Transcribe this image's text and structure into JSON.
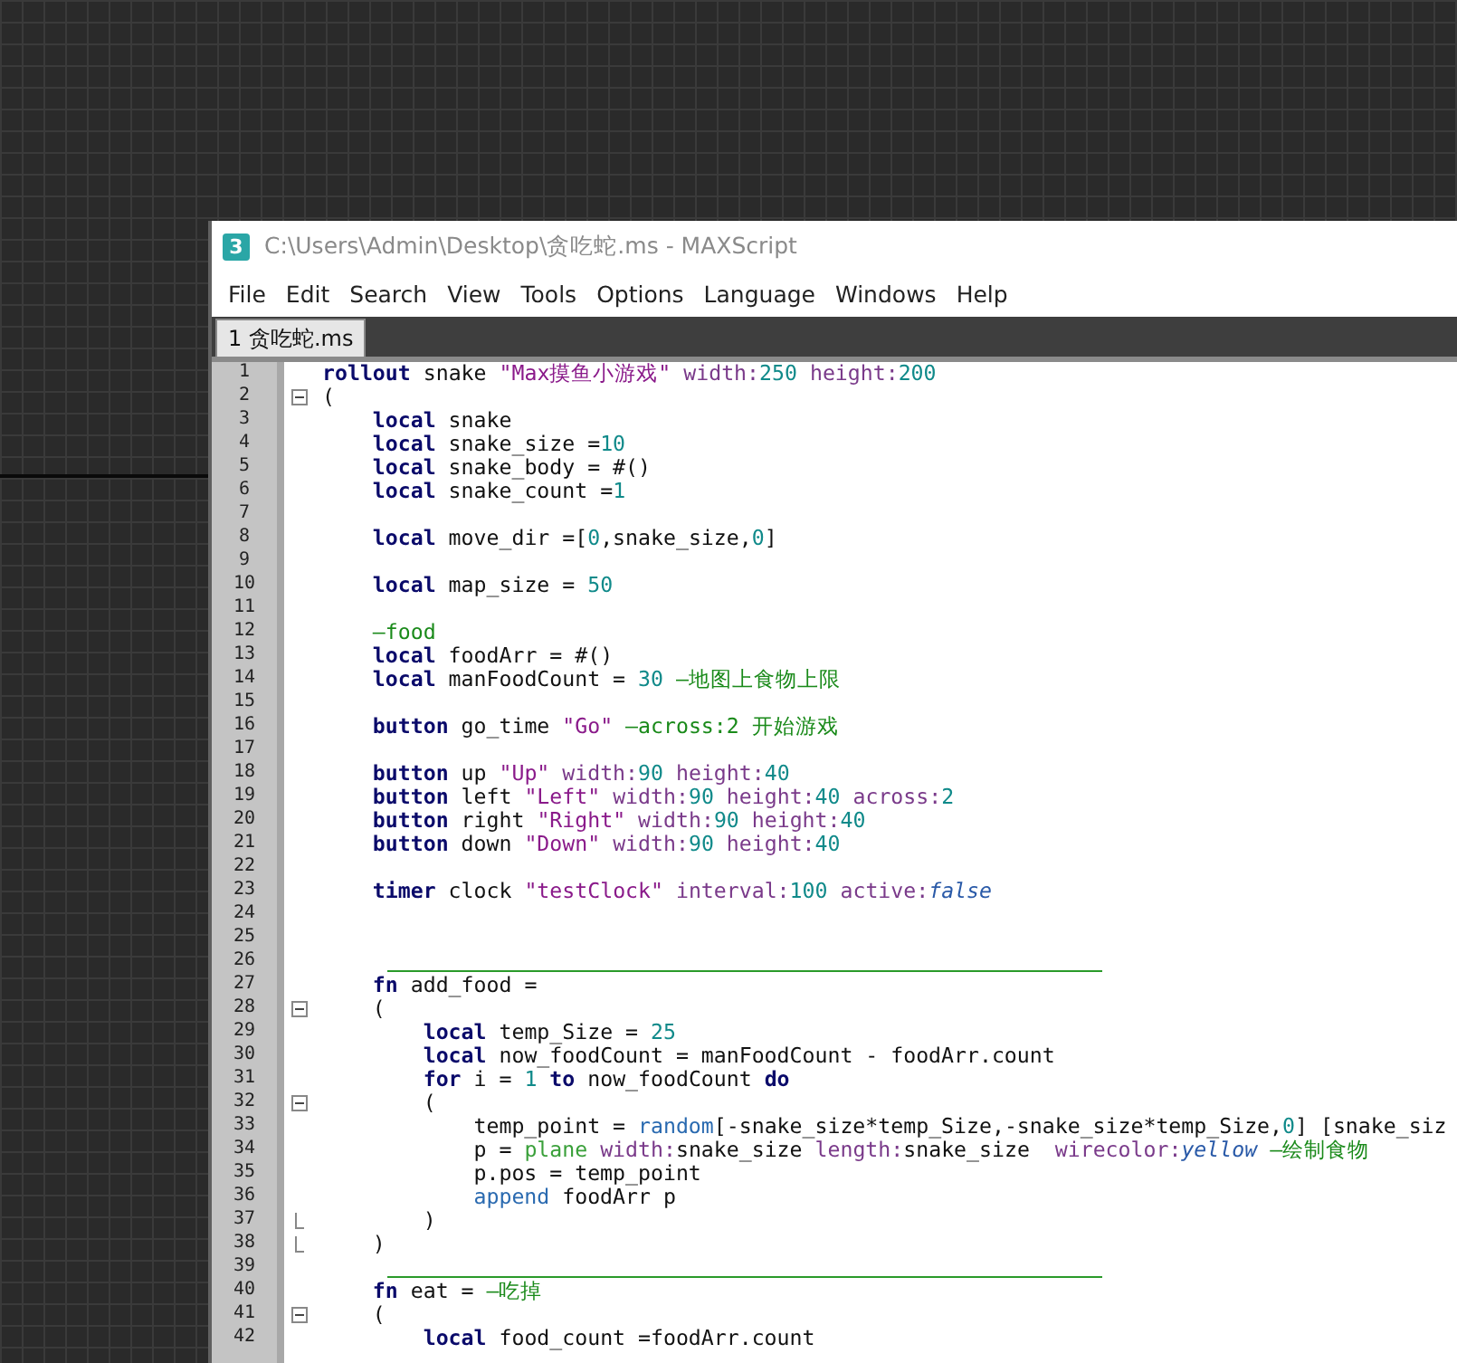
{
  "window": {
    "title": "C:\\Users\\Admin\\Desktop\\贪吃蛇.ms - MAXScript",
    "app_icon": "3"
  },
  "menu": [
    "File",
    "Edit",
    "Search",
    "View",
    "Tools",
    "Options",
    "Language",
    "Windows",
    "Help"
  ],
  "tabs": [
    {
      "label": "1 贪吃蛇.ms",
      "selected": true
    }
  ],
  "editor": {
    "lines": [
      {
        "number": "1",
        "tokens": [
          {
            "kind": "keyword",
            "text": "rollout"
          },
          {
            "kind": "text",
            "text": " snake "
          },
          {
            "kind": "string",
            "text": "\"Max摸鱼小游戏\""
          },
          {
            "kind": "property",
            "text": " width:"
          },
          {
            "kind": "number",
            "text": "250"
          },
          {
            "kind": "property",
            "text": " height:"
          },
          {
            "kind": "number",
            "text": "200"
          }
        ]
      },
      {
        "number": "2",
        "fold_marker": {
          "kind": "start"
        },
        "tokens": [
          {
            "kind": "text",
            "text": "("
          }
        ]
      },
      {
        "number": "3",
        "tokens": [
          {
            "kind": "keyword",
            "text": "    local"
          },
          {
            "kind": "text",
            "text": " snake"
          }
        ]
      },
      {
        "number": "4",
        "tokens": [
          {
            "kind": "keyword",
            "text": "    local"
          },
          {
            "kind": "text",
            "text": " snake_size ="
          },
          {
            "kind": "number",
            "text": "10"
          }
        ]
      },
      {
        "number": "5",
        "tokens": [
          {
            "kind": "keyword",
            "text": "    local"
          },
          {
            "kind": "text",
            "text": " snake_body = #()"
          }
        ]
      },
      {
        "number": "6",
        "tokens": [
          {
            "kind": "keyword",
            "text": "    local"
          },
          {
            "kind": "text",
            "text": " snake_count ="
          },
          {
            "kind": "number",
            "text": "1"
          }
        ]
      },
      {
        "number": "7"
      },
      {
        "number": "8",
        "tokens": [
          {
            "kind": "keyword",
            "text": "    local"
          },
          {
            "kind": "text",
            "text": " move_dir =["
          },
          {
            "kind": "number",
            "text": "0"
          },
          {
            "kind": "text",
            "text": ",snake_size,"
          },
          {
            "kind": "number",
            "text": "0"
          },
          {
            "kind": "text",
            "text": "]"
          }
        ]
      },
      {
        "number": "9"
      },
      {
        "number": "10",
        "tokens": [
          {
            "kind": "keyword",
            "text": "    local"
          },
          {
            "kind": "text",
            "text": " map_size = "
          },
          {
            "kind": "number",
            "text": "50"
          }
        ]
      },
      {
        "number": "11"
      },
      {
        "number": "12",
        "tokens": [
          {
            "kind": "comment",
            "text": "    —food"
          }
        ]
      },
      {
        "number": "13",
        "tokens": [
          {
            "kind": "keyword",
            "text": "    local"
          },
          {
            "kind": "text",
            "text": " foodArr = #()"
          }
        ]
      },
      {
        "number": "14",
        "tokens": [
          {
            "kind": "keyword",
            "text": "    local"
          },
          {
            "kind": "text",
            "text": " manFoodCount = "
          },
          {
            "kind": "number",
            "text": "30"
          },
          {
            "kind": "comment",
            "text": " —地图上食物上限"
          }
        ]
      },
      {
        "number": "15"
      },
      {
        "number": "16",
        "tokens": [
          {
            "kind": "keyword",
            "text": "    button"
          },
          {
            "kind": "text",
            "text": " go_time "
          },
          {
            "kind": "string",
            "text": "\"Go\""
          },
          {
            "kind": "comment",
            "text": " —across:2 开始游戏"
          }
        ]
      },
      {
        "number": "17"
      },
      {
        "number": "18",
        "tokens": [
          {
            "kind": "keyword",
            "text": "    button"
          },
          {
            "kind": "text",
            "text": " up "
          },
          {
            "kind": "string",
            "text": "\"Up\""
          },
          {
            "kind": "property",
            "text": " width:"
          },
          {
            "kind": "number",
            "text": "90"
          },
          {
            "kind": "property",
            "text": " height:"
          },
          {
            "kind": "number",
            "text": "40"
          }
        ]
      },
      {
        "number": "19",
        "tokens": [
          {
            "kind": "keyword",
            "text": "    button"
          },
          {
            "kind": "text",
            "text": " left "
          },
          {
            "kind": "string",
            "text": "\"Left\""
          },
          {
            "kind": "property",
            "text": " width:"
          },
          {
            "kind": "number",
            "text": "90"
          },
          {
            "kind": "property",
            "text": " height:"
          },
          {
            "kind": "number",
            "text": "40"
          },
          {
            "kind": "property",
            "text": " across:"
          },
          {
            "kind": "number",
            "text": "2"
          }
        ]
      },
      {
        "number": "20",
        "tokens": [
          {
            "kind": "keyword",
            "text": "    button"
          },
          {
            "kind": "text",
            "text": " right "
          },
          {
            "kind": "string",
            "text": "\"Right\""
          },
          {
            "kind": "property",
            "text": " width:"
          },
          {
            "kind": "number",
            "text": "90"
          },
          {
            "kind": "property",
            "text": " height:"
          },
          {
            "kind": "number",
            "text": "40"
          }
        ]
      },
      {
        "number": "21",
        "tokens": [
          {
            "kind": "keyword",
            "text": "    button"
          },
          {
            "kind": "text",
            "text": " down "
          },
          {
            "kind": "string",
            "text": "\"Down\""
          },
          {
            "kind": "property",
            "text": " width:"
          },
          {
            "kind": "number",
            "text": "90"
          },
          {
            "kind": "property",
            "text": " height:"
          },
          {
            "kind": "number",
            "text": "40"
          }
        ]
      },
      {
        "number": "22"
      },
      {
        "number": "23",
        "tokens": [
          {
            "kind": "keyword",
            "text": "    timer"
          },
          {
            "kind": "text",
            "text": " clock "
          },
          {
            "kind": "string",
            "text": "\"testClock\""
          },
          {
            "kind": "property",
            "text": " interval:"
          },
          {
            "kind": "number",
            "text": "100"
          },
          {
            "kind": "property",
            "text": " active:"
          },
          {
            "kind": "constant",
            "text": "false"
          }
        ]
      },
      {
        "number": "24"
      },
      {
        "number": "25"
      },
      {
        "number": "26",
        "separator": true
      },
      {
        "number": "27",
        "tokens": [
          {
            "kind": "keyword",
            "text": "    fn"
          },
          {
            "kind": "text",
            "text": " add_food ="
          }
        ]
      },
      {
        "number": "28",
        "fold_marker": {
          "kind": "start"
        },
        "tokens": [
          {
            "kind": "text",
            "text": "    ("
          }
        ]
      },
      {
        "number": "29",
        "tokens": [
          {
            "kind": "keyword",
            "text": "        local"
          },
          {
            "kind": "text",
            "text": " temp_Size = "
          },
          {
            "kind": "number",
            "text": "25"
          }
        ]
      },
      {
        "number": "30",
        "tokens": [
          {
            "kind": "keyword",
            "text": "        local"
          },
          {
            "kind": "text",
            "text": " now_foodCount = manFoodCount - foodArr.count"
          }
        ]
      },
      {
        "number": "31",
        "tokens": [
          {
            "kind": "keyword",
            "text": "        for"
          },
          {
            "kind": "text",
            "text": " i = "
          },
          {
            "kind": "number",
            "text": "1"
          },
          {
            "kind": "keyword",
            "text": " to"
          },
          {
            "kind": "text",
            "text": " now_foodCount "
          },
          {
            "kind": "keyword",
            "text": "do"
          }
        ]
      },
      {
        "number": "32",
        "fold_marker": {
          "kind": "start"
        },
        "tokens": [
          {
            "kind": "text",
            "text": "        ("
          }
        ]
      },
      {
        "number": "33",
        "tokens": [
          {
            "kind": "text",
            "text": "            temp_point = "
          },
          {
            "kind": "builtin",
            "text": "random"
          },
          {
            "kind": "text",
            "text": "[-snake_size*temp_Size,-snake_size*temp_Size,"
          },
          {
            "kind": "number",
            "text": "0"
          },
          {
            "kind": "text",
            "text": "] [snake_siz"
          }
        ]
      },
      {
        "number": "34",
        "tokens": [
          {
            "kind": "text",
            "text": "            p = "
          },
          {
            "kind": "class",
            "text": "plane"
          },
          {
            "kind": "property",
            "text": " width:"
          },
          {
            "kind": "text",
            "text": "snake_size "
          },
          {
            "kind": "property",
            "text": "length:"
          },
          {
            "kind": "text",
            "text": "snake_size  "
          },
          {
            "kind": "property",
            "text": "wirecolor:"
          },
          {
            "kind": "constant",
            "text": "yellow"
          },
          {
            "kind": "comment",
            "text": " —绘制食物"
          }
        ]
      },
      {
        "number": "35",
        "tokens": [
          {
            "kind": "text",
            "text": "            p.pos = temp_point"
          }
        ]
      },
      {
        "number": "36",
        "tokens": [
          {
            "kind": "builtin",
            "text": "            append"
          },
          {
            "kind": "text",
            "text": " foodArr p"
          }
        ]
      },
      {
        "number": "37",
        "fold_marker": {
          "kind": "end"
        },
        "tokens": [
          {
            "kind": "text",
            "text": "        )"
          }
        ]
      },
      {
        "number": "38",
        "fold_marker": {
          "kind": "end"
        },
        "tokens": [
          {
            "kind": "text",
            "text": "    )"
          }
        ]
      },
      {
        "number": "39",
        "separator": true
      },
      {
        "number": "40",
        "tokens": [
          {
            "kind": "keyword",
            "text": "    fn"
          },
          {
            "kind": "text",
            "text": " eat = "
          },
          {
            "kind": "comment",
            "text": "—吃掉"
          }
        ]
      },
      {
        "number": "41",
        "fold_marker": {
          "kind": "start"
        },
        "tokens": [
          {
            "kind": "text",
            "text": "    ("
          }
        ]
      },
      {
        "number": "42",
        "tokens": [
          {
            "kind": "keyword",
            "text": "        local"
          },
          {
            "kind": "text",
            "text": " food_count =foodArr.count"
          }
        ]
      }
    ]
  }
}
